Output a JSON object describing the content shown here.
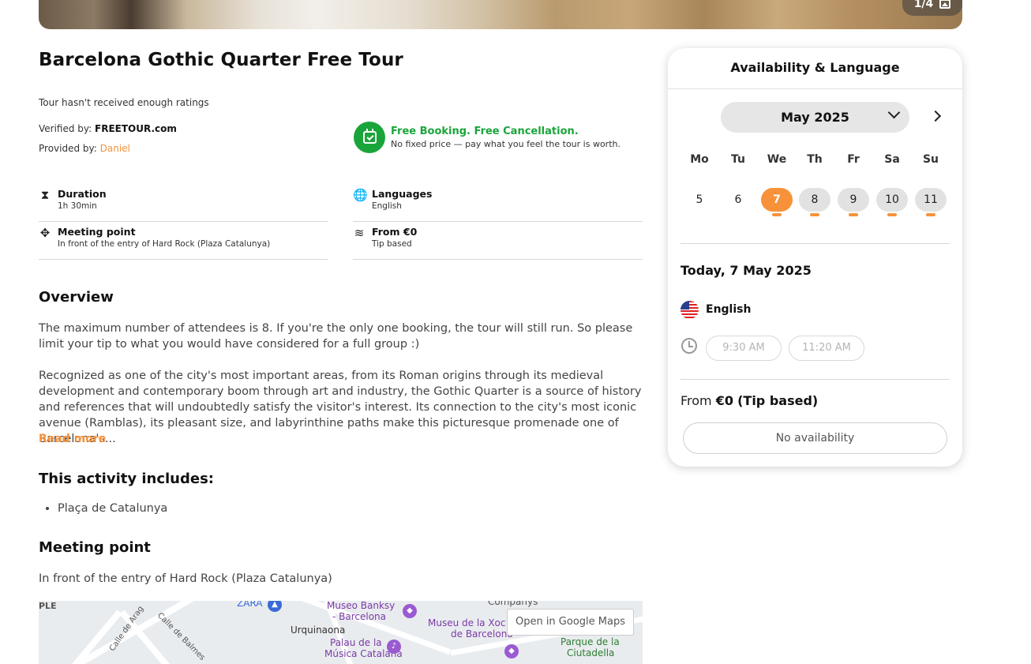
{
  "gallery": {
    "counter": "1/4",
    "icon": "images-icon"
  },
  "tour": {
    "title": "Barcelona Gothic Quarter Free Tour",
    "ratings_text": "Tour hasn't received enough ratings",
    "verified_label": "Verified by:",
    "verified_value": "FREETOUR.com",
    "provided_label": "Provided by:",
    "provided_value": "Daniel",
    "booking_title": "Free Booking. Free Cancellation.",
    "booking_sub": "No fixed price — pay what you feel the tour is worth."
  },
  "details": [
    {
      "icon": "hourglass-icon",
      "title": "Duration",
      "value": "1h 30min"
    },
    {
      "icon": "globe-icon",
      "title": "Languages",
      "value": "English"
    },
    {
      "icon": "move-icon",
      "title": "Meeting point",
      "value": "In front of the entry of Hard Rock (Plaza Catalunya)"
    },
    {
      "icon": "coins-icon",
      "title": "From €0",
      "value": "Tip based"
    }
  ],
  "overview": {
    "heading": "Overview",
    "p1": "The maximum number of attendees is 8. If you're the only one booking, the tour will still run. So please limit your tip to what you would have considered for a full group :)",
    "p2": "Recognized as one of the city's most important areas, from its Roman origins through its medieval development and contemporary boom through art and industry, the Gothic Quarter is a source of history and references that will undoubtedly satisfy the visitor's interest. Its connection to the city's most iconic avenue (Ramblas), its pleasant size, and labyrinthine paths make this picturesque promenade one of Barcelona's...",
    "read_more": "Read more"
  },
  "includes": {
    "heading": "This activity includes:",
    "items": [
      "Plaça de Catalunya"
    ]
  },
  "meeting": {
    "heading": "Meeting point",
    "text": "In front of the entry of Hard Rock (Plaza Catalunya)"
  },
  "map": {
    "button": "Open in Google Maps",
    "labels": [
      "ZARA",
      "Museo Banksy",
      "- Barcelona",
      "Urquinaona",
      "Palau de la",
      "Música Catalana",
      "Museu de la Xoc",
      "de Barcelona",
      "Parque de la",
      "Ciutadella",
      "Companys",
      "Calle de Arag",
      "Calle de Balmes",
      "PLE"
    ]
  },
  "booking_panel": {
    "title": "Availability & Language",
    "month": "May 2025",
    "weekdays": [
      "Mo",
      "Tu",
      "We",
      "Th",
      "Fr",
      "Sa",
      "Su"
    ],
    "days": [
      {
        "label": "5",
        "state": "unavailable"
      },
      {
        "label": "6",
        "state": "unavailable"
      },
      {
        "label": "7",
        "state": "selected"
      },
      {
        "label": "8",
        "state": "available"
      },
      {
        "label": "9",
        "state": "available"
      },
      {
        "label": "10",
        "state": "available"
      },
      {
        "label": "11",
        "state": "available"
      }
    ],
    "selected_date": "Today, 7 May 2025",
    "language": "English",
    "times": [
      "9:30 AM",
      "11:20 AM"
    ],
    "price_prefix": "From",
    "price": "€0",
    "price_note": "(Tip based)",
    "no_availability": "No availability",
    "accent_color": "#f7923a"
  }
}
